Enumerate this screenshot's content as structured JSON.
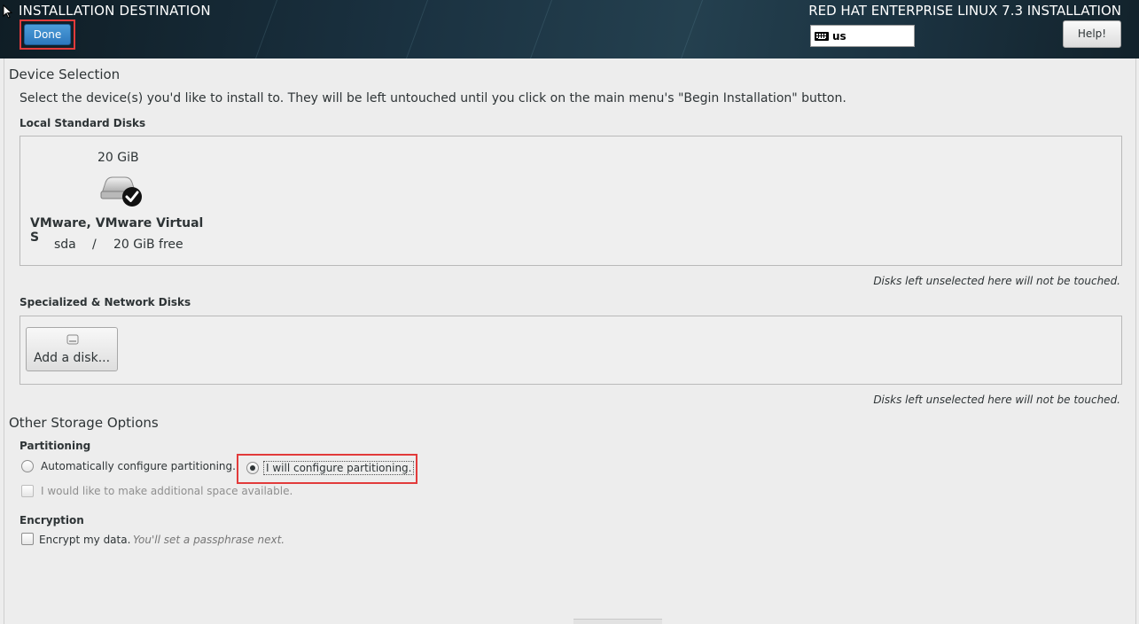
{
  "header": {
    "title": "INSTALLATION DESTINATION",
    "done_label": "Done",
    "product": "RED HAT ENTERPRISE LINUX 7.3 INSTALLATION",
    "keyboard_layout": "us",
    "help_label": "Help!"
  },
  "device_selection": {
    "title": "Device Selection",
    "instruction": "Select the device(s) you'd like to install to.  They will be left untouched until you click on the main menu's \"Begin Installation\" button.",
    "local_disks_label": "Local Standard Disks",
    "disk": {
      "size": "20 GiB",
      "name": "VMware, VMware Virtual S",
      "device": "sda",
      "separator": "/",
      "free": "20 GiB free",
      "selected": true
    },
    "local_note": "Disks left unselected here will not be touched.",
    "specialized_label": "Specialized & Network Disks",
    "add_disk_label": "Add a disk...",
    "specialized_note": "Disks left unselected here will not be touched."
  },
  "other_storage": {
    "title": "Other Storage Options",
    "partitioning_label": "Partitioning",
    "auto_partition_label": "Automatically configure partitioning.",
    "manual_partition_label": "I will configure partitioning.",
    "selected_option": "manual",
    "additional_space_label": "I would like to make additional space available.",
    "encryption_label": "Encryption",
    "encrypt_label": "Encrypt my data.",
    "encrypt_hint": "You'll set a passphrase next."
  },
  "colors": {
    "header_bg": "#1a3140",
    "done_button": "#3584d0",
    "highlight": "#e23b3b",
    "page_bg": "#ededed"
  }
}
